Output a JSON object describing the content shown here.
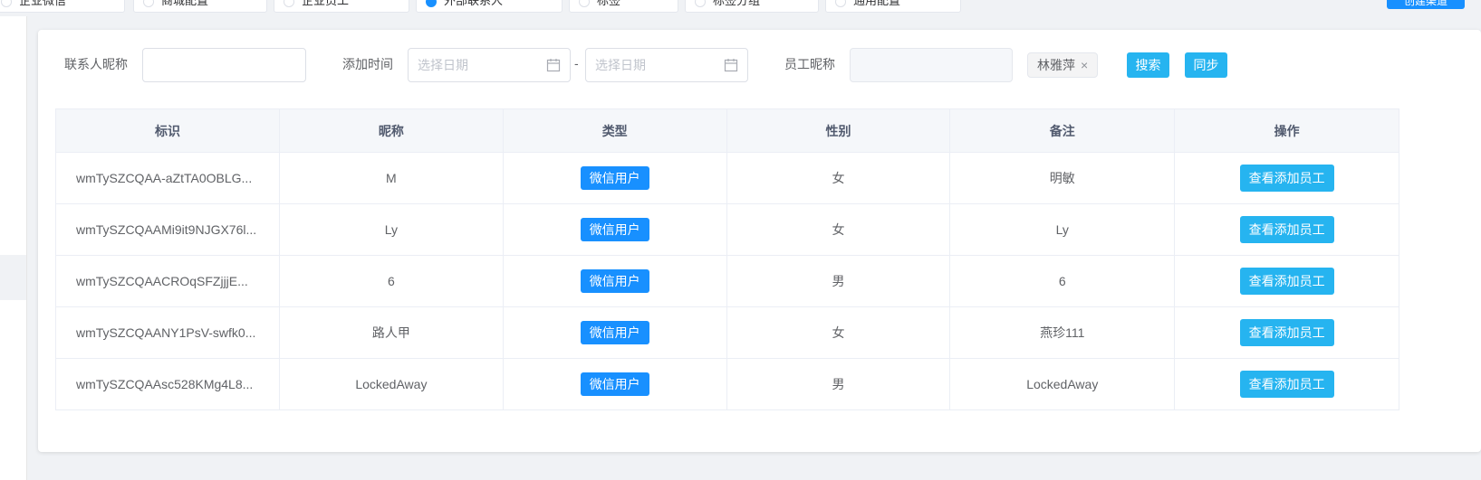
{
  "top_tabs": [
    {
      "label": "企业微信",
      "active": false
    },
    {
      "label": "商城配置",
      "active": false
    },
    {
      "label": "企业员工",
      "active": false
    },
    {
      "label": "外部联系人",
      "active": true
    },
    {
      "label": "标签",
      "active": false
    },
    {
      "label": "标签分组",
      "active": false
    },
    {
      "label": "通用配置",
      "active": false
    }
  ],
  "top_right_button": "创建渠道",
  "filters": {
    "contact_nickname_label": "联系人昵称",
    "contact_nickname_value": "",
    "add_time_label": "添加时间",
    "start_date_placeholder": "选择日期",
    "end_date_placeholder": "选择日期",
    "date_separator": "-",
    "employee_nickname_label": "员工昵称",
    "employee_tag": "林雅萍",
    "tag_close": "×",
    "search_button": "搜索",
    "sync_button": "同步"
  },
  "table": {
    "columns": [
      "标识",
      "昵称",
      "类型",
      "性别",
      "备注",
      "操作"
    ],
    "rows": [
      {
        "id": "wmTySZCQAA-aZtTA0OBLG...",
        "nickname": "M",
        "type": "微信用户",
        "gender": "女",
        "remark": "明敏",
        "action": "查看添加员工"
      },
      {
        "id": "wmTySZCQAAMi9it9NJGX76l...",
        "nickname": "Ly",
        "type": "微信用户",
        "gender": "女",
        "remark": "Ly",
        "action": "查看添加员工"
      },
      {
        "id": "wmTySZCQAACROqSFZjjjE...",
        "nickname": "6",
        "type": "微信用户",
        "gender": "男",
        "remark": "6",
        "action": "查看添加员工"
      },
      {
        "id": "wmTySZCQAANY1PsV-swfk0...",
        "nickname": "路人甲",
        "type": "微信用户",
        "gender": "女",
        "remark": "燕珍111",
        "action": "查看添加员工"
      },
      {
        "id": "wmTySZCQAAsc528KMg4L8...",
        "nickname": "LockedAway",
        "type": "微信用户",
        "gender": "男",
        "remark": "LockedAway",
        "action": "查看添加员工"
      }
    ]
  },
  "colors": {
    "primary": "#1890ff",
    "action": "#26b4f0"
  }
}
